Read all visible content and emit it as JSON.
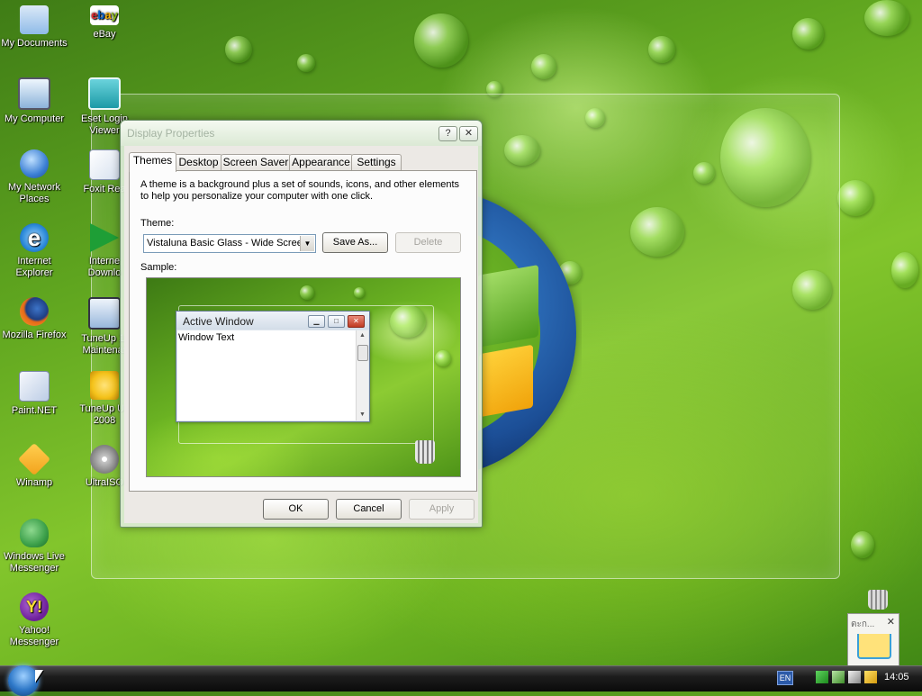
{
  "desktop": {
    "icons": [
      {
        "label": "My Documents",
        "icon": "my-documents-icon",
        "color": "#8fbbe8"
      },
      {
        "label": "My Computer",
        "icon": "my-computer-icon",
        "color": "#b6d6f2"
      },
      {
        "label": "My Network Places",
        "icon": "network-places-icon",
        "color": "#3b7fd4"
      },
      {
        "label": "Internet Explorer",
        "icon": "internet-explorer-icon",
        "color": "#2c8ad9"
      },
      {
        "label": "Mozilla Firefox",
        "icon": "firefox-icon",
        "color": "#e66a17"
      },
      {
        "label": "Paint.NET",
        "icon": "paint-net-icon",
        "color": "#d8e3f2"
      },
      {
        "label": "Winamp",
        "icon": "winamp-icon",
        "color": "#f2a21c"
      },
      {
        "label": "Windows Live Messenger",
        "icon": "messenger-icon",
        "color": "#3ca04a"
      },
      {
        "label": "Yahoo! Messenger",
        "icon": "yahoo-messenger-icon",
        "color": "#6d1f9a"
      },
      {
        "label": "eBay",
        "icon": "ebay-icon",
        "color": "#ffffff"
      },
      {
        "label": "Eset Login Viewer",
        "icon": "eset-icon",
        "color": "#1c9aa6"
      },
      {
        "label": "Foxit Rea",
        "icon": "foxit-reader-icon",
        "color": "#e9eef5"
      },
      {
        "label": "Interne Downlo",
        "icon": "internet-download-icon",
        "color": "#1e9e36"
      },
      {
        "label": "TuneUp 1-Maintenar",
        "icon": "tuneup-maintenance-icon",
        "color": "#d0e2f7"
      },
      {
        "label": "TuneUp Uti 2008",
        "icon": "tuneup-utilities-icon",
        "color": "#f4c21a"
      },
      {
        "label": "UltraISO",
        "icon": "ultraiso-icon",
        "color": "#c6c6c6"
      }
    ],
    "recycle_label": "Recycle Bin"
  },
  "dialog": {
    "title": "Display Properties",
    "help_label": "?",
    "close_label": "✕",
    "tabs": [
      {
        "label": "Themes",
        "active": true
      },
      {
        "label": "Desktop",
        "active": false
      },
      {
        "label": "Screen Saver",
        "active": false
      },
      {
        "label": "Appearance",
        "active": false
      },
      {
        "label": "Settings",
        "active": false
      }
    ],
    "description": "A theme is a background plus a set of sounds, icons, and other elements to help you personalize your computer with one click.",
    "theme_label": "Theme:",
    "theme_value": "Vistaluna Basic Glass - Wide Screen",
    "save_as_label": "Save As...",
    "delete_label": "Delete",
    "sample_label": "Sample:",
    "sample": {
      "window_title": "Active Window",
      "window_text": "Window Text"
    },
    "ok_label": "OK",
    "cancel_label": "Cancel",
    "apply_label": "Apply"
  },
  "taskbar": {
    "language": "EN",
    "clock": "14:05"
  },
  "popup": {
    "title": "ตะก...",
    "close": "✕"
  }
}
